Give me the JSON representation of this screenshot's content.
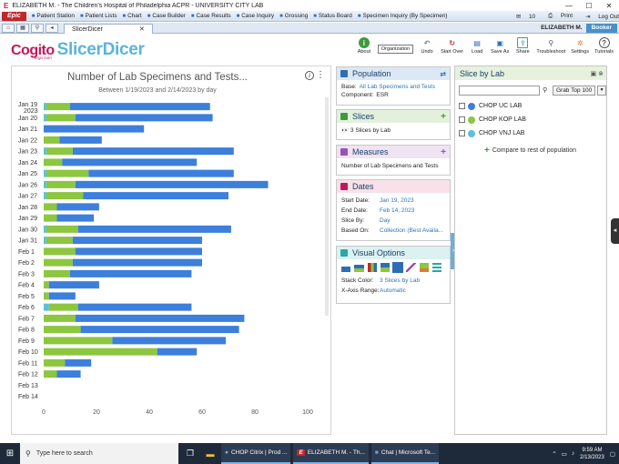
{
  "window": {
    "title": "ELIZABETH M. - The Children's Hospital of Philadelphia ACPR - UNIVERSITY CITY LAB",
    "min": "—",
    "max": "☐",
    "close": "✕"
  },
  "epicbar": {
    "epic_label": "Epic",
    "items": [
      "Patient Station",
      "Patient Lists",
      "Chart",
      "Case Builder",
      "Case Results",
      "Case Inquiry",
      "Grossing",
      "Status Board",
      "Specimen Inquiry (By Specimen)"
    ],
    "mail_count": "10",
    "print_label": "Print",
    "logout_label": "Log Out"
  },
  "tabbar": {
    "tab_label": "SlicerDicer",
    "user_label": "ELIZABETH M.",
    "booker_label": "Booker"
  },
  "header": {
    "logo_cogito": "Cogito",
    "logo_cogito_sub": "ergo sum",
    "logo_product": "SlicerDicer",
    "tools": [
      {
        "label": "About",
        "color": "#3d9a3d",
        "glyph": "i"
      },
      {
        "label": "Undo",
        "color": "#777777",
        "glyph": "↶"
      },
      {
        "label": "Start Over",
        "color": "#c62828",
        "glyph": "↻"
      },
      {
        "label": "Load",
        "color": "#2e6db4",
        "glyph": "▤"
      },
      {
        "label": "Save As",
        "color": "#2e6db4",
        "glyph": "▣"
      },
      {
        "label": "Share",
        "color": "#2aa7a7",
        "glyph": "⇪"
      },
      {
        "label": "Troubleshoot",
        "color": "#555555",
        "glyph": "⚲"
      },
      {
        "label": "Settings",
        "color": "#e07b39",
        "glyph": "✲"
      },
      {
        "label": "Tutorials",
        "color": "#555555",
        "glyph": "?"
      }
    ],
    "organization_label": "Organization"
  },
  "chart_data": {
    "type": "bar",
    "orientation": "horizontal",
    "stacked": true,
    "title": "Number of Lab Specimens and Tests...",
    "subtitle": "Between 1/19/2023 and 2/14/2023 by day",
    "categories": [
      "Jan 19 2023",
      "Jan 20",
      "Jan 21",
      "Jan 22",
      "Jan 23",
      "Jan 24",
      "Jan 25",
      "Jan 26",
      "Jan 27",
      "Jan 28",
      "Jan 29",
      "Jan 30",
      "Jan 31",
      "Feb 1",
      "Feb 2",
      "Feb 3",
      "Feb 4",
      "Feb 5",
      "Feb 6",
      "Feb 7",
      "Feb 8",
      "Feb 9",
      "Feb 10",
      "Feb 11",
      "Feb 12",
      "Feb 13",
      "Feb 14"
    ],
    "series": [
      {
        "color": "#5bc0de",
        "values": [
          1,
          1,
          0,
          0,
          1,
          0,
          1,
          1,
          1,
          0,
          0,
          1,
          1,
          0,
          0,
          0,
          0,
          0,
          2,
          0,
          0,
          0,
          0,
          0,
          0,
          0,
          0
        ]
      },
      {
        "color": "#8dc63f",
        "values": [
          9,
          11,
          0,
          6,
          10,
          7,
          16,
          11,
          14,
          5,
          5,
          12,
          10,
          12,
          11,
          10,
          2,
          2,
          11,
          12,
          14,
          26,
          43,
          8,
          5,
          0,
          0
        ]
      },
      {
        "color": "#3c7fdc",
        "values": [
          53,
          52,
          38,
          16,
          61,
          51,
          55,
          73,
          55,
          16,
          14,
          58,
          49,
          48,
          49,
          46,
          19,
          10,
          43,
          64,
          60,
          43,
          15,
          10,
          9,
          0,
          0
        ]
      }
    ],
    "xlim": [
      0,
      100
    ],
    "xticks": [
      0,
      20,
      40,
      60,
      80,
      100
    ],
    "grid": false
  },
  "population": {
    "title": "Population",
    "base_label": "Base:",
    "base_value": "All Lab Specimens and Tests",
    "component_label": "Component:",
    "component_value": "ESR"
  },
  "slices": {
    "title": "Slices",
    "item": "3 Slices by Lab"
  },
  "measures": {
    "title": "Measures",
    "item": "Number of Lab Specimens and Tests"
  },
  "dates": {
    "title": "Dates",
    "rows": [
      {
        "k": "Start Date:",
        "v": "Jan 19, 2023"
      },
      {
        "k": "End Date:",
        "v": "Feb 14, 2023"
      },
      {
        "k": "Slice By:",
        "v": "Day"
      },
      {
        "k": "Based On:",
        "v": "Collection (Best Availa..."
      }
    ]
  },
  "visual": {
    "title": "Visual Options",
    "stack_label": "Stack Color:",
    "stack_value": "3 Slices by Lab",
    "xaxis_label": "X-Axis Range:",
    "xaxis_value": "Automatic"
  },
  "slice_panel": {
    "title": "Slice by Lab",
    "search_placeholder": "",
    "grab_label": "Grab Top 100",
    "items": [
      {
        "label": "CHOP UC LAB",
        "color": "#3c7fdc"
      },
      {
        "label": "CHOP KOP LAB",
        "color": "#8dc63f"
      },
      {
        "label": "CHOP VNJ LAB",
        "color": "#5bc0de"
      }
    ],
    "compare_label": "Compare to rest of population"
  },
  "taskbar": {
    "search_placeholder": "Type here to search",
    "apps": [
      "CHOP Citrix | Prod ...",
      "ELIZABETH M. - Th...",
      "Chat | Microsoft Te..."
    ],
    "time": "9:59 AM",
    "date": "2/13/2023"
  }
}
